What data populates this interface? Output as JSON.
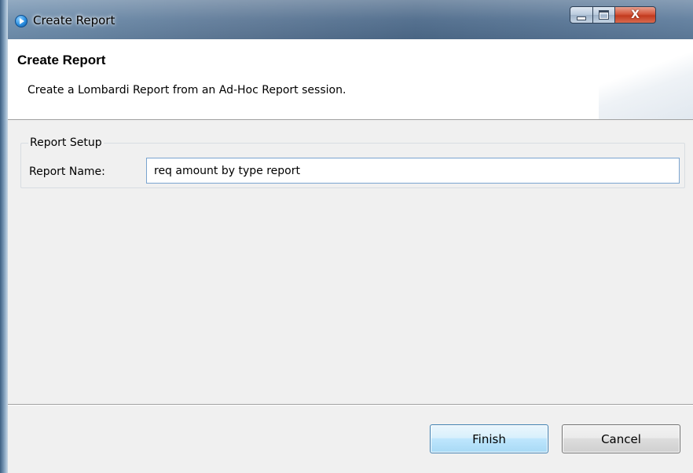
{
  "window": {
    "title": "Create Report",
    "app_icon": "play-circle-icon",
    "controls": {
      "minimize": "minimize-icon",
      "maximize": "maximize-icon",
      "close_glyph": "X"
    }
  },
  "header": {
    "title": "Create Report",
    "description": "Create a Lombardi Report from an Ad-Hoc Report session."
  },
  "report_setup": {
    "group_label": "Report Setup",
    "name_label": "Report Name:",
    "name_value": "req amount by type report"
  },
  "buttons": {
    "finish": "Finish",
    "cancel": "Cancel"
  },
  "colors": {
    "default_button_border": "#3c7fb1",
    "close_button": "#c23a1e",
    "input_border": "#7aa4cf"
  }
}
